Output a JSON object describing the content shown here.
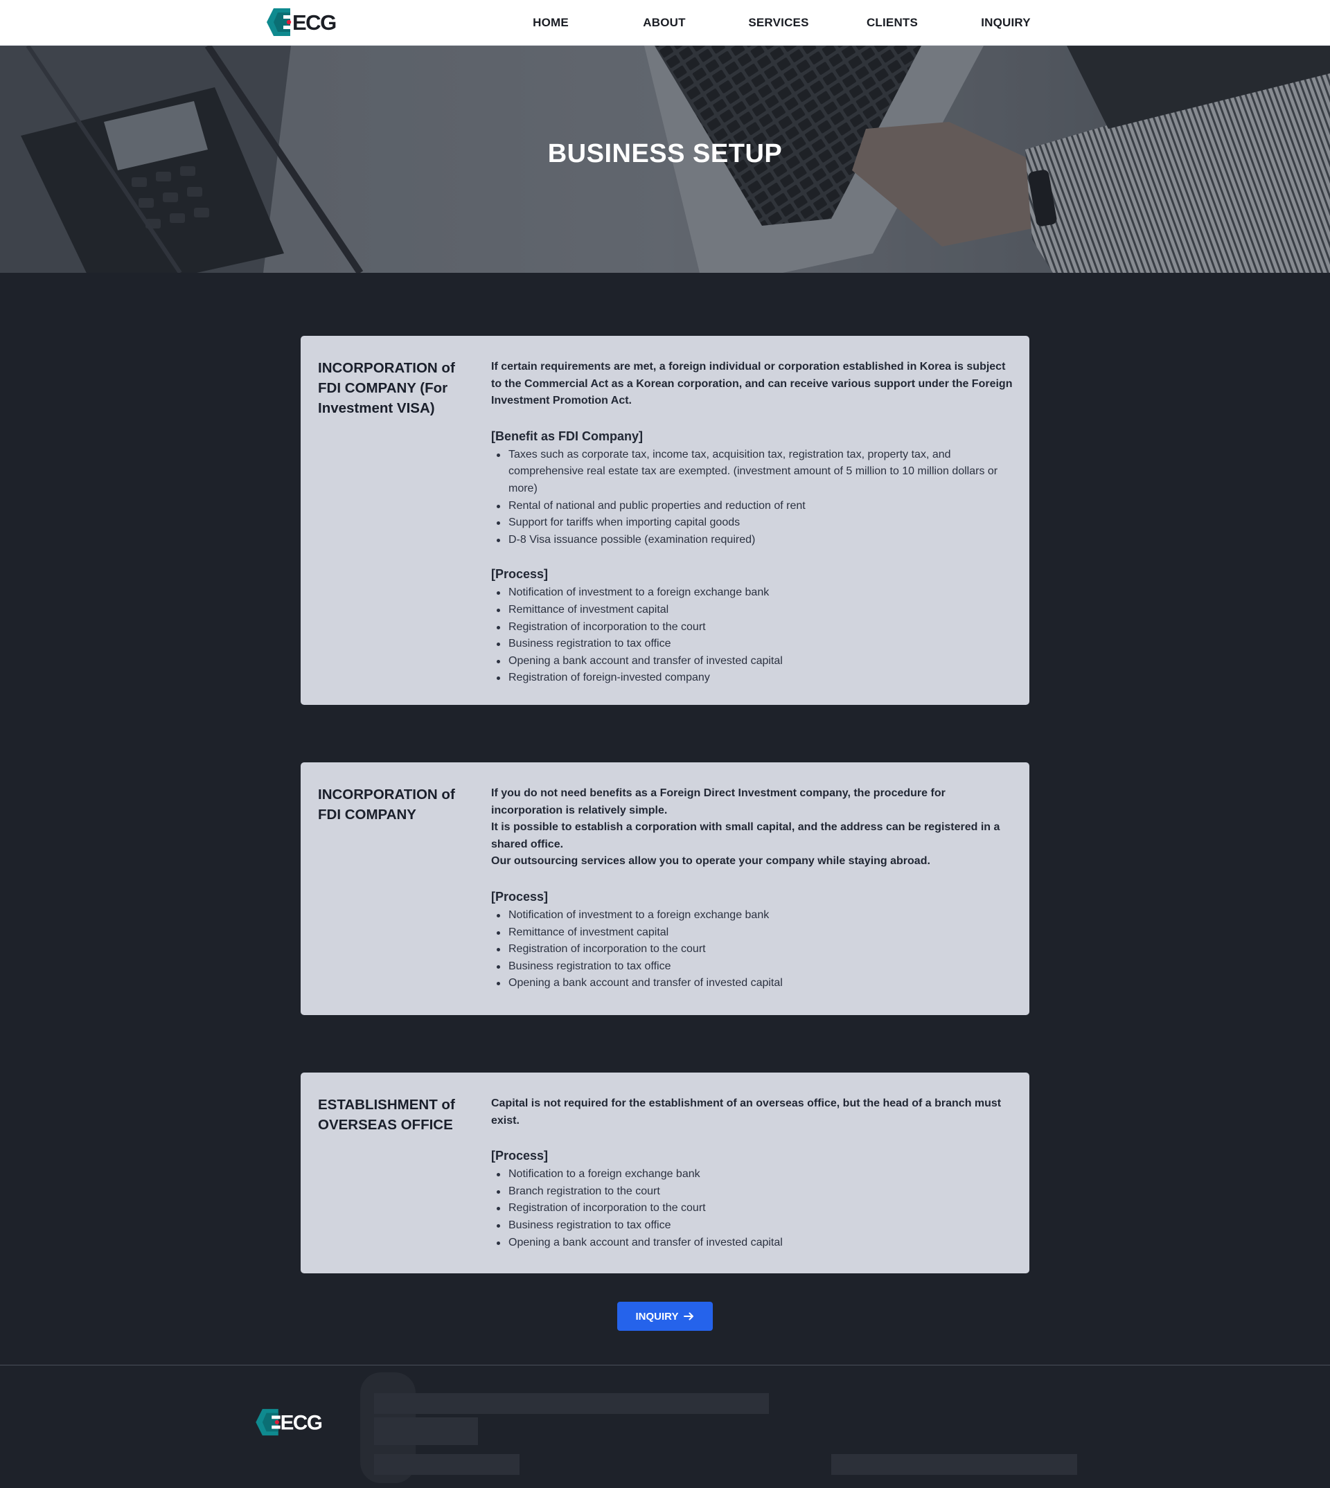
{
  "header": {
    "logo_text": "ECG",
    "nav": [
      {
        "label": "HOME"
      },
      {
        "label": "ABOUT"
      },
      {
        "label": "SERVICES"
      },
      {
        "label": "CLIENTS"
      },
      {
        "label": "INQUIRY"
      }
    ]
  },
  "hero": {
    "title": "BUSINESS SETUP"
  },
  "cards": [
    {
      "title": "INCORPORATION of FDI COMPANY (For Investment VISA)",
      "intro": "If certain requirements are met, a foreign individual or corporation established in Korea is subject to the Commercial Act as a Korean corporation, and can receive various support under the Foreign Investment Promotion Act.",
      "sections": [
        {
          "heading": "[Benefit as FDI Company]",
          "items": [
            "Taxes such as corporate tax, income tax, acquisition tax, registration tax, property tax, and comprehensive real estate tax are exempted. (investment amount of 5 million to 10 million dollars or more)",
            "Rental of national and public properties and reduction of rent",
            "Support for tariffs when importing capital goods",
            "D-8 Visa issuance possible (examination required)"
          ]
        },
        {
          "heading": "[Process]",
          "items": [
            "Notification of investment to a foreign exchange bank",
            "Remittance of investment capital",
            "Registration of incorporation to the court",
            "Business registration to tax office",
            "Opening a bank account and transfer of invested capital",
            "Registration of foreign-invested company"
          ]
        }
      ]
    },
    {
      "title": "INCORPORATION of FDI COMPANY",
      "intro_lines": [
        "If you do not need benefits as a Foreign Direct Investment company, the procedure for incorporation is relatively simple.",
        "It is possible to establish a corporation with small capital, and the address can be registered in a shared office.",
        "Our outsourcing services allow you to operate your company while staying abroad."
      ],
      "sections": [
        {
          "heading": "[Process]",
          "items": [
            "Notification of investment to a foreign exchange bank",
            "Remittance of investment capital",
            "Registration of incorporation to the court",
            "Business registration to tax office",
            "Opening a bank account and transfer of invested capital"
          ]
        }
      ]
    },
    {
      "title": "ESTABLISHMENT of OVERSEAS OFFICE",
      "intro": "Capital is not required for the establishment of an overseas office, but the head of a branch must exist.",
      "sections": [
        {
          "heading": "[Process]",
          "items": [
            "Notification to a foreign exchange bank",
            "Branch registration to the court",
            "Registration of incorporation to the court",
            "Business registration to tax office",
            "Opening a bank account and transfer of invested capital"
          ]
        }
      ]
    }
  ],
  "cta": {
    "label": "INQUIRY",
    "icon": "arrow-right-icon"
  },
  "footer": {
    "logo_text": "ECG"
  },
  "colors": {
    "brand_teal": "#0f8a8f",
    "brand_red": "#e11d3a",
    "page_bg": "#1e222a",
    "card_bg": "#d1d4dd",
    "button": "#2563eb"
  }
}
